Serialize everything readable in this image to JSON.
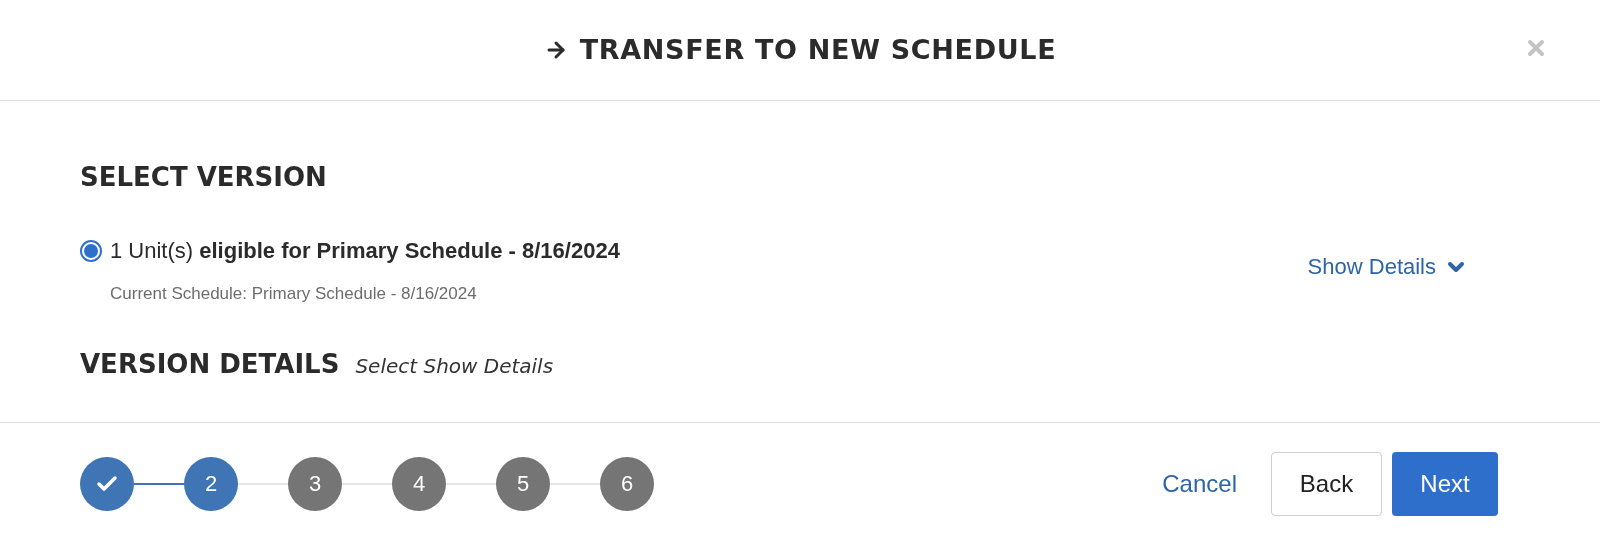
{
  "dialog": {
    "title": "TRANSFER TO NEW SCHEDULE"
  },
  "select_version": {
    "heading": "SELECT VERSION",
    "options": [
      {
        "label": "1 Unit(s) **eligible for Primary Schedule - 8/16/2024**",
        "current": "Current Schedule: Primary Schedule - 8/16/2024",
        "selected": true
      }
    ],
    "show_details": "Show Details"
  },
  "version_details": {
    "heading": "VERSION DETAILS",
    "hint": "Select Show Details"
  },
  "steps": [
    {
      "selected": false
    },
    {
      "label": "2",
      "selected": true
    },
    {
      "label": "3",
      "selected": false
    },
    {
      "label": "4",
      "selected": false
    },
    {
      "label": "5",
      "selected": false
    },
    {
      "label": "6",
      "selected": false
    }
  ],
  "buttons": {
    "cancel": "Cancel",
    "back": "Back",
    "next": "Next"
  }
}
